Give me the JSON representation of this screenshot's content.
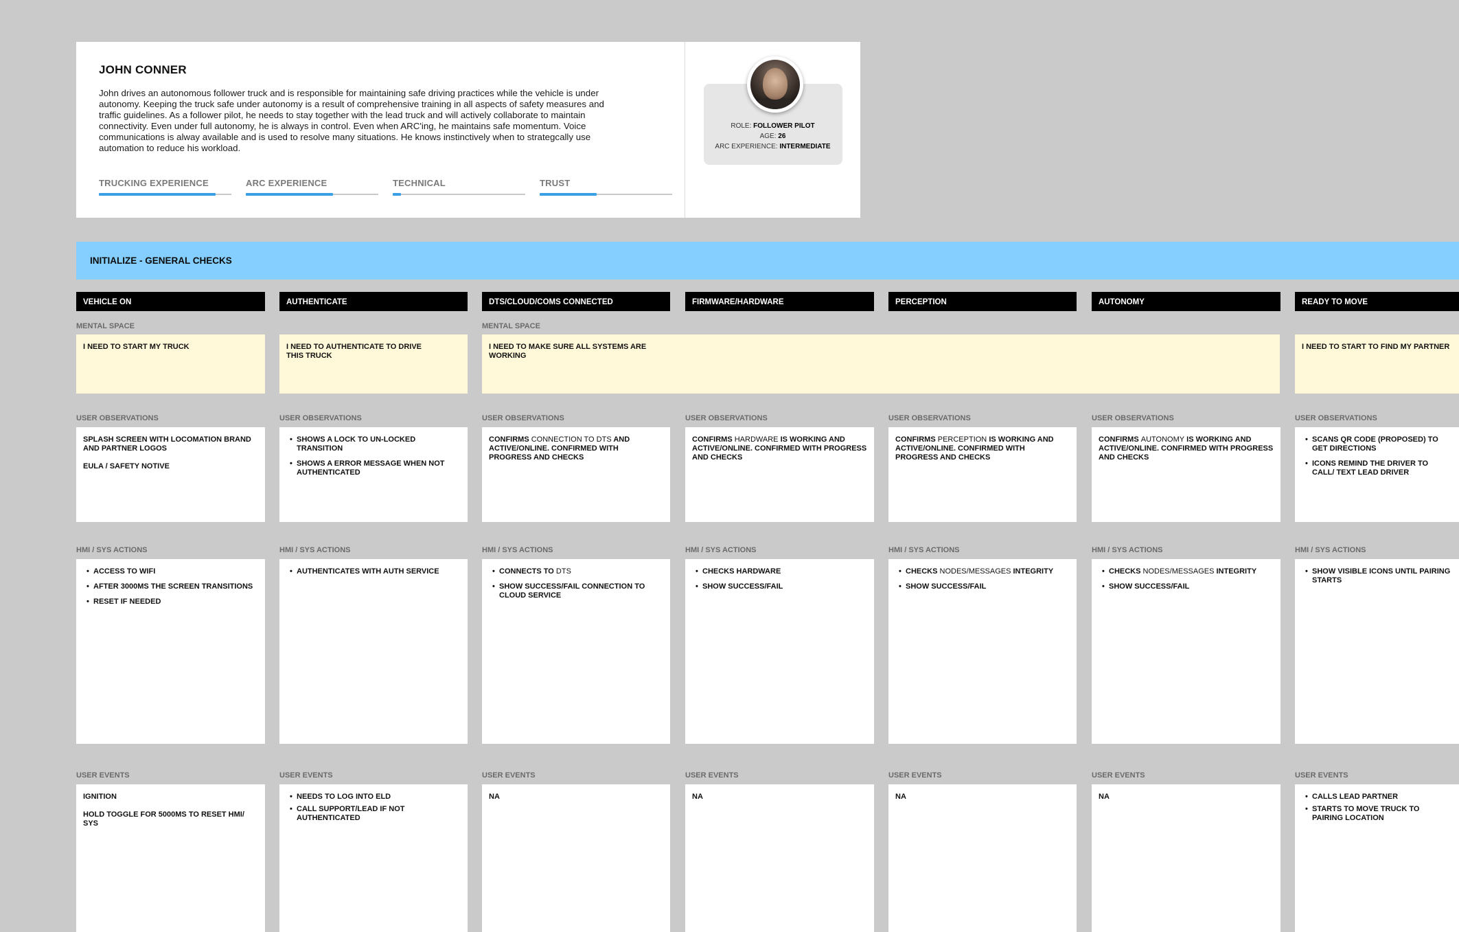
{
  "persona": {
    "name": "JOHN CONNER",
    "bio": "John drives an autonomous follower truck and is responsible for maintaining safe driving practices while the vehicle is under autonomy. Keeping the truck safe under autonomy is a result of comprehensive training in all aspects of safety measures and traffic guidelines. As a follower pilot, he needs to stay together with the lead truck and will actively collaborate to maintain connectivity. Even under full autonomy, he is always in control. Even when ARC'ing, he maintains safe momentum. Voice communications is alway available and is used to resolve many situations. He knows instinctively when to strategcally use automation to reduce his workload.",
    "meters": [
      {
        "label": "TRUCKING EXPERIENCE",
        "level": 0.88
      },
      {
        "label": "ARC EXPERIENCE",
        "level": 0.66
      },
      {
        "label": "TECHNICAL",
        "level": 0.06
      },
      {
        "label": "TRUST",
        "level": 0.43
      }
    ],
    "role_label": "ROLE:",
    "role": "FOLLOWER PILOT",
    "age_label": "AGE:",
    "age": "26",
    "arc_label": "ARC EXPERIENCE:",
    "arc": "INTERMEDIATE"
  },
  "stage": {
    "title": "INITIALIZE - GENERAL CHECKS"
  },
  "labels": {
    "mental": "MENTAL SPACE",
    "observations": "USER OBSERVATIONS",
    "actions": "HMI / SYS ACTIONS",
    "events": "USER EVENTS"
  },
  "columns": [
    {
      "title": "VEHICLE ON"
    },
    {
      "title": "AUTHENTICATE"
    },
    {
      "title": "DTS/CLOUD/COMS CONNECTED"
    },
    {
      "title": "FIRMWARE/HARDWARE"
    },
    {
      "title": "PERCEPTION"
    },
    {
      "title": "AUTONOMY"
    },
    {
      "title": "READY TO MOVE"
    }
  ],
  "mental": [
    "I NEED TO START MY TRUCK",
    "I NEED TO AUTHENTICATE TO DRIVE THIS TRUCK",
    "I NEED TO MAKE SURE ALL SYSTEMS ARE WORKING",
    "I NEED TO START TO FIND MY PARTNER"
  ],
  "observations": {
    "c0": {
      "p1": "SPLASH SCREEN WITH LOCOMATION BRAND AND PARTNER LOGOS",
      "p2": "EULA / SAFETY NOTIVE"
    },
    "c1": {
      "li1": "SHOWS A LOCK TO UN-LOCKED TRANSITION",
      "li2": "SHOWS A ERROR MESSAGE WHEN NOT AUTHENTICATED"
    },
    "c2": {
      "a": "CONFIRMS",
      "b": "CONNECTION TO DTS",
      "c": "AND ACTIVE/ONLINE. CONFIRMED WITH PROGRESS AND CHECKS"
    },
    "c3": {
      "a": "CONFIRMS",
      "b": "HARDWARE",
      "c": "IS WORKING AND ACTIVE/ONLINE. CONFIRMED WITH PROGRESS AND CHECKS"
    },
    "c4": {
      "a": "CONFIRMS",
      "b": "PERCEPTION",
      "c": "IS WORKING AND ACTIVE/ONLINE. CONFIRMED WITH PROGRESS AND CHECKS"
    },
    "c5": {
      "a": "CONFIRMS",
      "b": "AUTONOMY",
      "c": "IS WORKING AND ACTIVE/ONLINE. CONFIRMED WITH PROGRESS AND CHECKS"
    },
    "c6": {
      "li1": "SCANS QR CODE (PROPOSED) TO GET DIRECTIONS",
      "li2": "ICONS REMIND THE DRIVER TO CALL/ TEXT LEAD DRIVER"
    }
  },
  "actions": {
    "c0": {
      "li1": "ACCESS TO WIFI",
      "li2": "AFTER 3000MS THE SCREEN TRANSITIONS",
      "li3": "RESET IF NEEDED"
    },
    "c1": {
      "li1": "AUTHENTICATES WITH AUTH SERVICE"
    },
    "c2": {
      "li1a": "CONNECTS TO",
      "li1b": "DTS",
      "li2": "SHOW SUCCESS/FAIL CONNECTION TO CLOUD SERVICE"
    },
    "c3": {
      "li1": "CHECKS HARDWARE",
      "li2": "SHOW SUCCESS/FAIL"
    },
    "c4": {
      "li1a": "CHECKS",
      "li1b": "NODES/MESSAGES",
      "li1c": "INTEGRITY",
      "li2": "SHOW SUCCESS/FAIL"
    },
    "c5": {
      "li1a": "CHECKS",
      "li1b": "NODES/MESSAGES",
      "li1c": "INTEGRITY",
      "li2": "SHOW SUCCESS/FAIL"
    },
    "c6": {
      "li1": "SHOW VISIBLE ICONS UNTIL PAIRING STARTS"
    }
  },
  "events": {
    "c0": {
      "p1": "IGNITION",
      "p2": "HOLD TOGGLE FOR 5000MS TO RESET HMI/ SYS"
    },
    "c1": {
      "li1": "NEEDS TO LOG INTO ELD",
      "li2": "CALL SUPPORT/LEAD IF NOT AUTHENTICATED"
    },
    "c2": {
      "p1": "NA"
    },
    "c3": {
      "p1": "NA"
    },
    "c4": {
      "p1": "NA"
    },
    "c5": {
      "p1": "NA"
    }
  },
  "events_c6": {
    "li1": "CALLS LEAD PARTNER",
    "li2": "STARTS TO MOVE TRUCK TO PAIRING LOCATION"
  }
}
